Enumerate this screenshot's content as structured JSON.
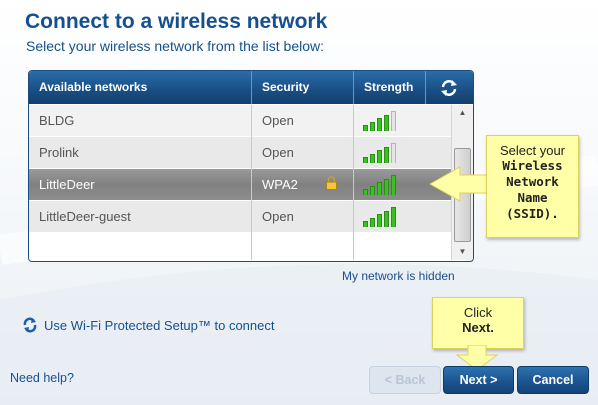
{
  "header": {
    "title": "Connect to a wireless network",
    "subtitle": "Select your wireless network from the list below:"
  },
  "table": {
    "columns": [
      "Available networks",
      "Security",
      "Strength"
    ],
    "refresh_icon": "refresh-icon",
    "rows": [
      {
        "name": "BLDG",
        "security": "Open",
        "locked": false,
        "strength": 4
      },
      {
        "name": "Prolink",
        "security": "Open",
        "locked": false,
        "strength": 4
      },
      {
        "name": "LittleDeer",
        "security": "WPA2",
        "locked": true,
        "strength": 5
      },
      {
        "name": "LittleDeer-guest",
        "security": "Open",
        "locked": false,
        "strength": 5
      }
    ],
    "selected_row": 2,
    "max_strength": 5
  },
  "callouts": {
    "ssid": {
      "line1": "Select your",
      "line2": "Wireless",
      "line3": "Network",
      "line4": "Name",
      "line5": "(SSID)."
    },
    "next": {
      "line1": "Click",
      "line2": "Next."
    }
  },
  "links": {
    "hidden_network": "My network is hidden",
    "wps": "Use Wi-Fi Protected Setup™ to connect",
    "help": "Need help?"
  },
  "buttons": {
    "back": "< Back",
    "next": "Next >",
    "cancel": "Cancel"
  },
  "colors": {
    "accent": "#16508f",
    "header_bg": "#1b5289",
    "signal": "#3cbf21",
    "callout": "#ffffa8"
  }
}
